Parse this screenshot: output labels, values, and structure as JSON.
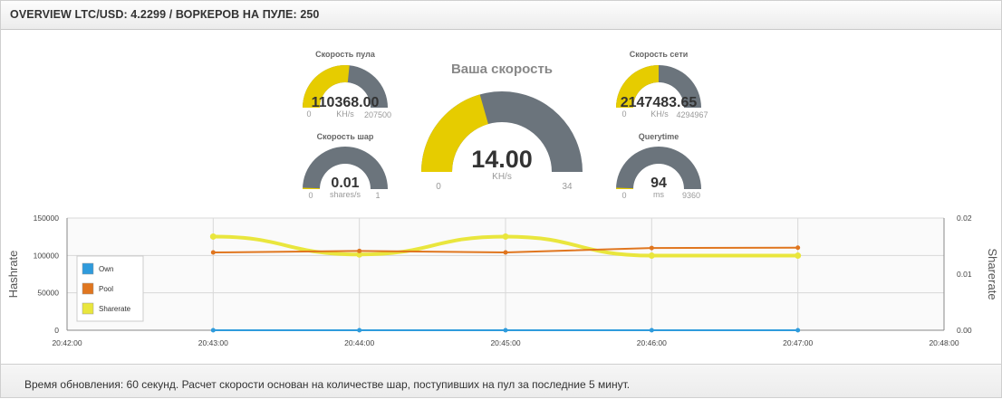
{
  "header": {
    "title": "OVERVIEW LTC/USD: 4.2299 / ВОРКЕРОВ НА ПУЛЕ: 250"
  },
  "gauges": {
    "pool_speed": {
      "title": "Скорость пула",
      "value": "110368.00",
      "numeric": 110368,
      "unit": "KH/s",
      "min": "0",
      "max": "207500",
      "min_v": 0,
      "max_v": 207500
    },
    "shares_speed": {
      "title": "Скорость шар",
      "value": "0.01",
      "numeric": 0.01,
      "unit": "shares/s",
      "min": "0",
      "max": "1",
      "min_v": 0,
      "max_v": 1
    },
    "your_speed": {
      "title": "Ваша скорость",
      "value": "14.00",
      "numeric": 14,
      "unit": "KH/s",
      "min": "0",
      "max": "34",
      "min_v": 0,
      "max_v": 34
    },
    "net_speed": {
      "title": "Скорость сети",
      "value": "2147483.65",
      "numeric": 2147483.65,
      "unit": "KH/s",
      "min": "0",
      "max": "4294967",
      "min_v": 0,
      "max_v": 4294967
    },
    "querytime": {
      "title": "Querytime",
      "value": "94",
      "numeric": 94,
      "unit": "ms",
      "min": "0",
      "max": "9360",
      "min_v": 0,
      "max_v": 9360
    }
  },
  "colors": {
    "gauge_fill": "#e6cc00",
    "gauge_bg": "#6b747c",
    "own": "#2f9bdc",
    "pool": "#e0761f",
    "sharerate": "#e9e63d"
  },
  "chart_data": {
    "type": "line",
    "x": [
      "20:43:00",
      "20:44:00",
      "20:45:00",
      "20:46:00",
      "20:47:00"
    ],
    "x_ticks": [
      "20:42:00",
      "20:43:00",
      "20:44:00",
      "20:45:00",
      "20:46:00",
      "20:47:00",
      "20:48:00"
    ],
    "ylabel": "Hashrate",
    "y2label": "Sharerate",
    "ylim": [
      0,
      150000
    ],
    "y_ticks": [
      "0",
      "50000",
      "100000",
      "150000"
    ],
    "y2lim": [
      0,
      0.02
    ],
    "y2_ticks": [
      "0.00",
      "0.01",
      "0.02"
    ],
    "grid": true,
    "legend_position": "left",
    "series": [
      {
        "name": "Own",
        "axis": "left",
        "values": [
          14,
          14,
          14,
          14,
          14
        ]
      },
      {
        "name": "Pool",
        "axis": "left",
        "values": [
          104000,
          106000,
          104000,
          110000,
          110368
        ]
      },
      {
        "name": "Sharerate",
        "axis": "right",
        "values": [
          0.0167,
          0.0135,
          0.0167,
          0.0133,
          0.0133
        ]
      }
    ]
  },
  "footer": {
    "text": "Время обновления: 60 секунд. Расчет скорости основан на количестве шар, поступивших на пул за последние 5 минут."
  }
}
